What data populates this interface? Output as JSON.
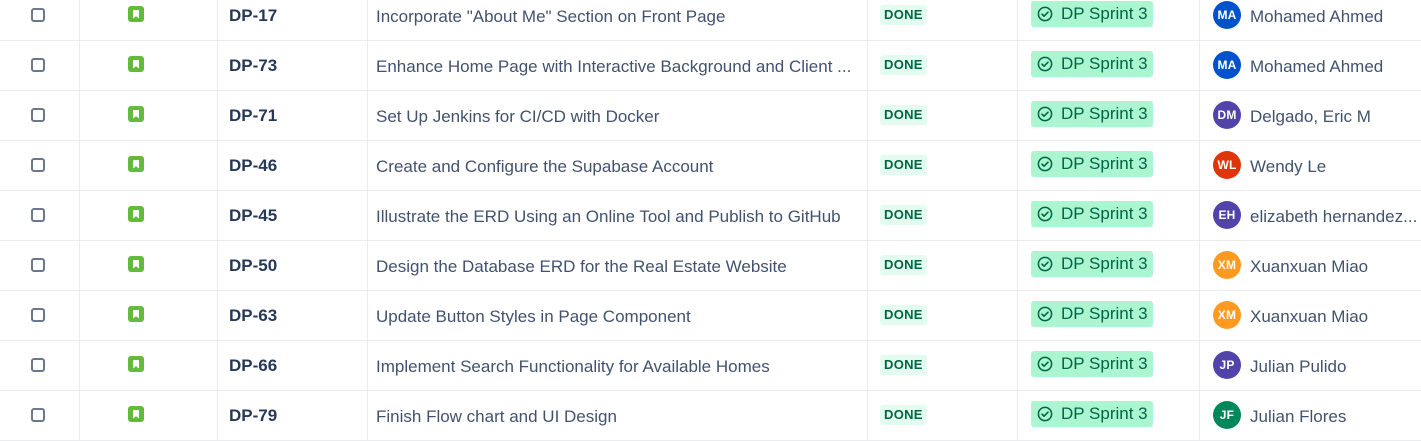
{
  "issues": [
    {
      "key": "DP-17",
      "summary": "Incorporate \"About Me\" Section on Front Page",
      "status": "DONE",
      "sprint": "DP Sprint 3",
      "assignee": {
        "initials": "MA",
        "name": "Mohamed Ahmed",
        "color": "#0052cc"
      }
    },
    {
      "key": "DP-73",
      "summary": "Enhance Home Page with Interactive Background and Client ...",
      "status": "DONE",
      "sprint": "DP Sprint 3",
      "assignee": {
        "initials": "MA",
        "name": "Mohamed Ahmed",
        "color": "#0052cc"
      }
    },
    {
      "key": "DP-71",
      "summary": "Set Up Jenkins for CI/CD with Docker",
      "status": "DONE",
      "sprint": "DP Sprint 3",
      "assignee": {
        "initials": "DM",
        "name": "Delgado, Eric M",
        "color": "#5243aa"
      }
    },
    {
      "key": "DP-46",
      "summary": "Create and Configure the Supabase Account",
      "status": "DONE",
      "sprint": "DP Sprint 3",
      "assignee": {
        "initials": "WL",
        "name": "Wendy Le",
        "color": "#de350b"
      }
    },
    {
      "key": "DP-45",
      "summary": "Illustrate the ERD Using an Online Tool and Publish to GitHub",
      "status": "DONE",
      "sprint": "DP Sprint 3",
      "assignee": {
        "initials": "EH",
        "name": "elizabeth hernandez...",
        "color": "#5243aa"
      }
    },
    {
      "key": "DP-50",
      "summary": "Design the Database ERD for the Real Estate Website",
      "status": "DONE",
      "sprint": "DP Sprint 3",
      "assignee": {
        "initials": "XM",
        "name": "Xuanxuan Miao",
        "color": "#ff991f"
      }
    },
    {
      "key": "DP-63",
      "summary": "Update Button Styles in Page Component",
      "status": "DONE",
      "sprint": "DP Sprint 3",
      "assignee": {
        "initials": "XM",
        "name": "Xuanxuan Miao",
        "color": "#ff991f"
      }
    },
    {
      "key": "DP-66",
      "summary": "Implement Search Functionality for Available Homes",
      "status": "DONE",
      "sprint": "DP Sprint 3",
      "assignee": {
        "initials": "JP",
        "name": "Julian Pulido",
        "color": "#5243aa"
      }
    },
    {
      "key": "DP-79",
      "summary": "Finish Flow chart and UI Design",
      "status": "DONE",
      "sprint": "DP Sprint 3",
      "assignee": {
        "initials": "JF",
        "name": "Julian Flores",
        "color": "#00875a"
      }
    }
  ],
  "icons": {
    "type": "story-icon",
    "sprint": "check-circle-icon",
    "select": "checkbox"
  },
  "colors": {
    "story": "#63ba3c",
    "status_bg": "#e3fcef",
    "status_text": "#006644",
    "sprint_bg": "#abf5d1"
  }
}
